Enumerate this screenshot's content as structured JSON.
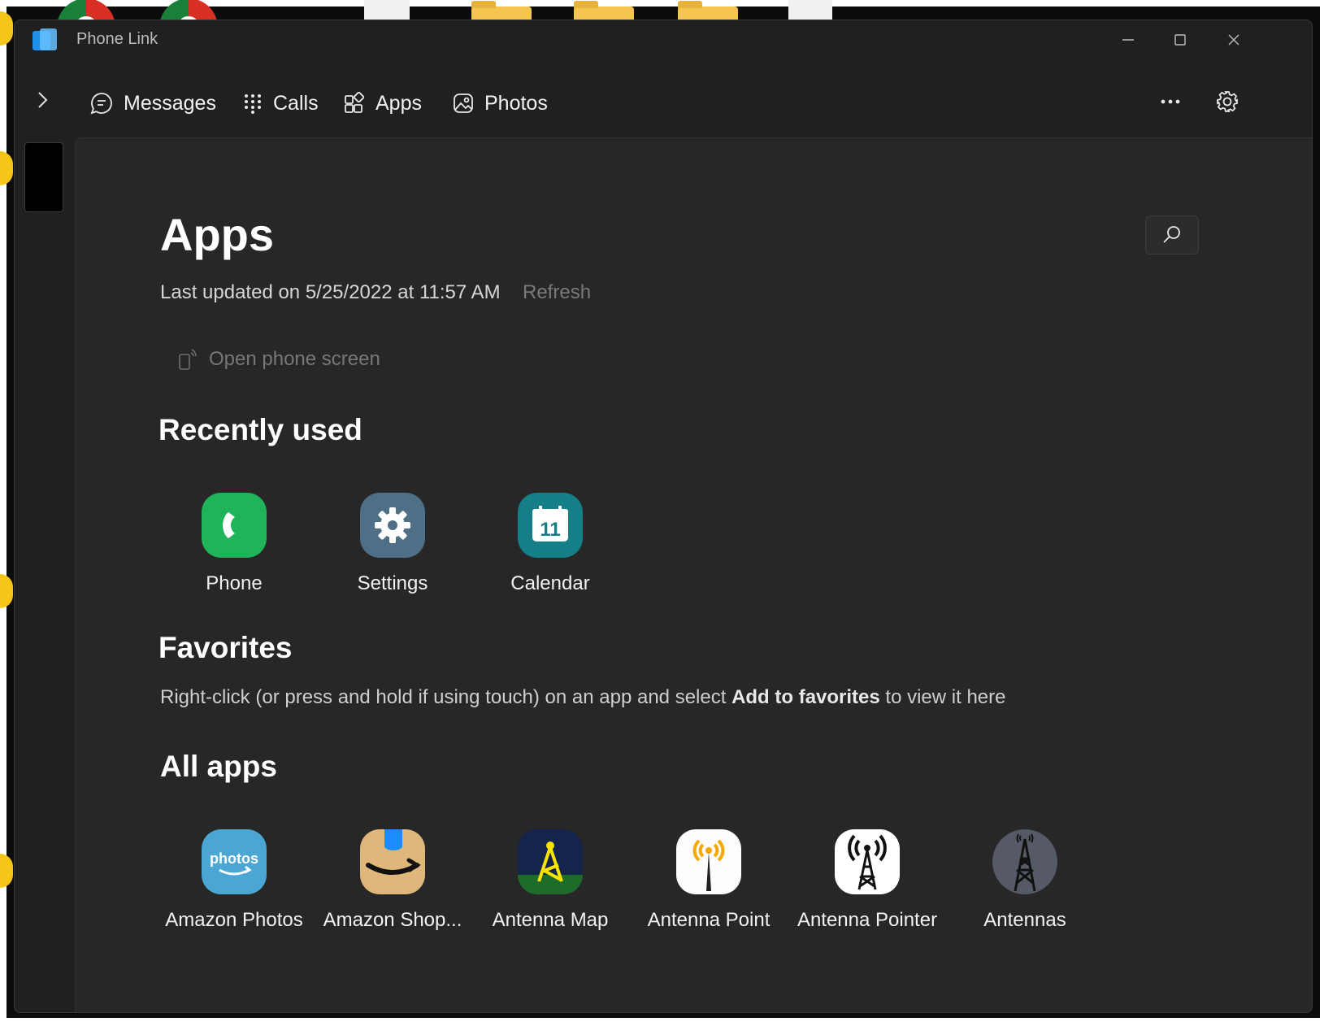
{
  "window": {
    "title": "Phone Link"
  },
  "nav": {
    "tabs": [
      {
        "label": "Messages",
        "icon": "message-icon"
      },
      {
        "label": "Calls",
        "icon": "dialpad-icon"
      },
      {
        "label": "Apps",
        "icon": "apps-icon",
        "selected": true
      },
      {
        "label": "Photos",
        "icon": "photos-icon"
      }
    ]
  },
  "page": {
    "title": "Apps",
    "last_updated": "Last updated on 5/25/2022 at 11:57 AM",
    "refresh_label": "Refresh",
    "open_phone_screen": "Open phone screen"
  },
  "recently_used": {
    "heading": "Recently used",
    "apps": [
      {
        "label": "Phone",
        "icon": "phone-app-icon"
      },
      {
        "label": "Settings",
        "icon": "settings-app-icon"
      },
      {
        "label": "Calendar",
        "icon": "calendar-app-icon",
        "badge": "11"
      }
    ]
  },
  "favorites": {
    "heading": "Favorites",
    "note_before": "Right-click (or press and hold if using touch) on an app and select ",
    "note_bold": "Add to favorites",
    "note_after": " to view it here"
  },
  "all_apps": {
    "heading": "All apps",
    "apps": [
      {
        "label": "Amazon Photos",
        "icon": "amazon-photos-icon",
        "icon_text": "photos"
      },
      {
        "label": "Amazon Shop...",
        "icon": "amazon-shopping-icon"
      },
      {
        "label": "Antenna Map",
        "icon": "antenna-map-icon"
      },
      {
        "label": "Antenna Point",
        "icon": "antenna-point-icon"
      },
      {
        "label": "Antenna Pointer",
        "icon": "antenna-pointer-icon"
      },
      {
        "label": "Antennas",
        "icon": "antennas-icon"
      }
    ]
  },
  "colors": {
    "window_bg": "#202020",
    "content_bg": "#272727",
    "phone_green": "#1fb35a",
    "settings_slate": "#4e6f86",
    "calendar_teal": "#147f86"
  }
}
